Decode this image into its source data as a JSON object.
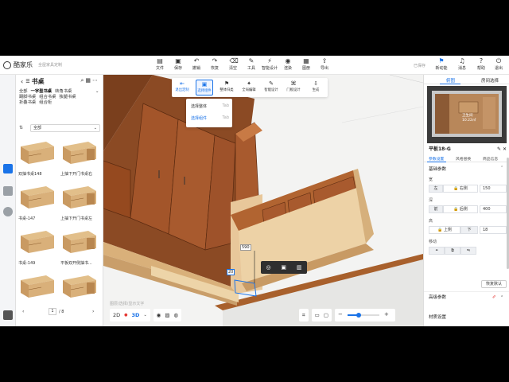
{
  "app": {
    "logo_text": "酷家乐",
    "logo_sub": "全屋家具定制",
    "save_status": "已保存"
  },
  "toolbar": [
    {
      "label": "文件",
      "icon": "file-icon"
    },
    {
      "label": "保存",
      "icon": "save-icon"
    },
    {
      "label": "撤销",
      "icon": "undo-icon"
    },
    {
      "label": "恢复",
      "icon": "redo-icon"
    },
    {
      "label": "清空",
      "icon": "clear-icon"
    },
    {
      "label": "工具",
      "icon": "tools-icon"
    },
    {
      "label": "智能设计",
      "icon": "smart-design-icon"
    },
    {
      "label": "渲染",
      "icon": "render-icon"
    },
    {
      "label": "图册",
      "icon": "album-icon"
    },
    {
      "label": "导出",
      "icon": "export-icon"
    }
  ],
  "right_toolbar": [
    {
      "label": "新动能",
      "icon": "bookmark-icon"
    },
    {
      "label": "消息",
      "icon": "bell-icon"
    },
    {
      "label": "帮助",
      "icon": "help-icon"
    },
    {
      "label": "退出",
      "icon": "exit-icon"
    }
  ],
  "left_panel": {
    "title": "书桌",
    "categories": [
      "全部",
      "一字型书桌",
      "转角书桌",
      "踢脚书桌",
      "组合书桌",
      "独腿书桌",
      "折叠书桌",
      "组合柜"
    ],
    "active_category": "一字型书桌",
    "filter_value": "全部",
    "items": [
      {
        "label": "双抽书桌148"
      },
      {
        "label": "上抽下开门书桌右"
      },
      {
        "label": "书桌-147"
      },
      {
        "label": "上抽下开门书桌左"
      },
      {
        "label": "书桌-149"
      },
      {
        "label": "平板双开侧抽书..."
      },
      {
        "label": ""
      },
      {
        "label": ""
      }
    ],
    "page": "1",
    "total_pages": "/ 8"
  },
  "canvas_toolbar": [
    {
      "label": "退出定制",
      "icon": "exit-custom-icon",
      "active": true
    },
    {
      "label": "选择组件",
      "icon": "select-component-icon",
      "active": true,
      "selected": true
    },
    {
      "label": "整体归类",
      "icon": "group-icon"
    },
    {
      "label": "全局编辑",
      "icon": "global-edit-icon"
    },
    {
      "label": "智能设计",
      "icon": "smart-icon"
    },
    {
      "label": "门板设计",
      "icon": "door-design-icon"
    },
    {
      "label": "生成",
      "icon": "generate-icon"
    }
  ],
  "select_menu": [
    {
      "label": "选择整体",
      "key": "Tab",
      "active": false
    },
    {
      "label": "选择组件",
      "key": "Tab",
      "active": true
    }
  ],
  "dimensions": {
    "height_label": "590",
    "thickness_label": "20"
  },
  "watermark": "图层/选择/显示文字",
  "view": {
    "mode2d": "2D",
    "mode3d": "3D"
  },
  "zoom_level": 0.35,
  "right_panel": {
    "tabs": [
      "俯图",
      "房间选择"
    ],
    "mini_map_label": "卫生间",
    "mini_map_area": "10.22㎡",
    "part_name": "平板18-G",
    "part_tabs": [
      "参数设置",
      "风格替换",
      "商品信息"
    ],
    "basic_params": "基础参数",
    "width_label": "宽",
    "width_left": "左",
    "width_mode": "右侧",
    "width_value": "150",
    "depth_label": "深",
    "depth_left": "前",
    "depth_mode": "后侧",
    "depth_value": "400",
    "height_label": "高",
    "height_mode": "上侧",
    "height_mode2": "下",
    "height_value": "18",
    "move_label": "移动",
    "reset_label": "恢复默认",
    "advanced_params": "高级参数",
    "material_label": "材质设置"
  }
}
